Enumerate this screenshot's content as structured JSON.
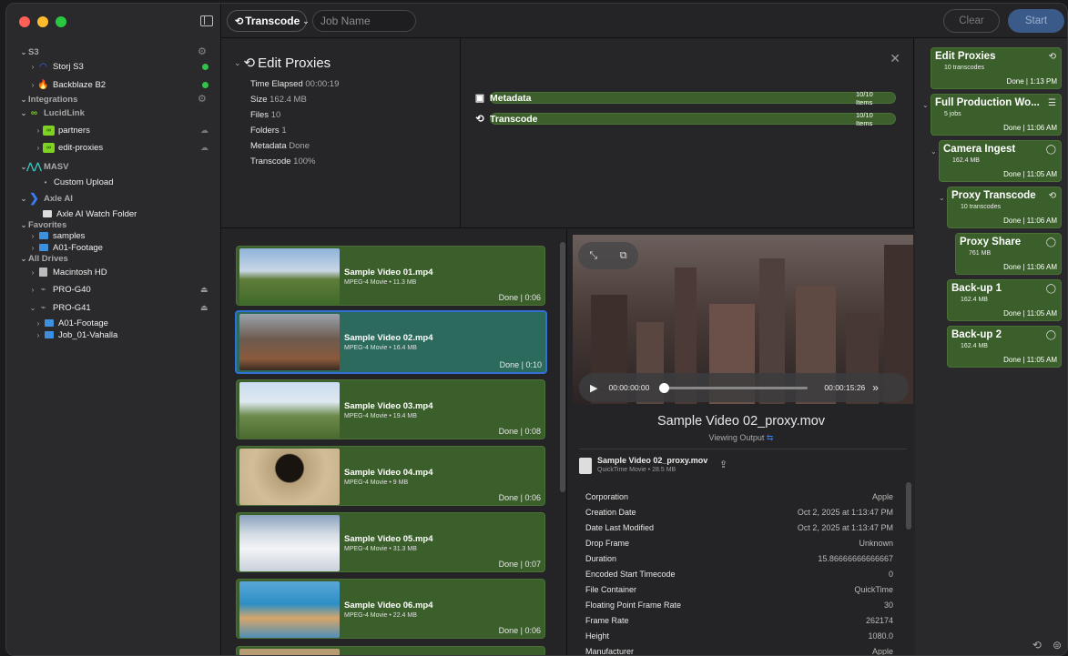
{
  "toolbar": {
    "mode": "Transcode",
    "job_name_placeholder": "Job Name",
    "clear": "Clear",
    "start": "Start"
  },
  "sidebar": {
    "s3": {
      "label": "S3",
      "items": [
        "Storj S3",
        "Backblaze B2"
      ]
    },
    "integrations": {
      "label": "Integrations"
    },
    "lucidlink": {
      "label": "LucidLink",
      "items": [
        "partners",
        "edit-proxies"
      ]
    },
    "masv": {
      "label": "MASV",
      "items": [
        "Custom Upload"
      ]
    },
    "axle": {
      "label": "Axle AI",
      "items": [
        "Axle AI Watch Folder"
      ]
    },
    "favorites": {
      "label": "Favorites",
      "items": [
        "samples",
        "A01-Footage"
      ]
    },
    "drives": {
      "label": "All Drives",
      "items": [
        "Macintosh HD",
        "PRO-G40",
        "PRO-G41"
      ],
      "sub": [
        "A01-Footage",
        "Job_01-Vahalla"
      ]
    }
  },
  "summary": {
    "title": "Edit Proxies",
    "rows": [
      {
        "k": "Time Elapsed",
        "v": "00:00:19"
      },
      {
        "k": "Size",
        "v": "162.4 MB"
      },
      {
        "k": "Files",
        "v": "10"
      },
      {
        "k": "Folders",
        "v": "1"
      },
      {
        "k": "Metadata",
        "v": "Done"
      },
      {
        "k": "Transcode",
        "v": "100%"
      }
    ]
  },
  "tasks": [
    {
      "name": "Metadata",
      "count": "10/10 Items",
      "progress": 1.0
    },
    {
      "name": "Transcode",
      "count": "10/10 Items",
      "progress": 1.0
    }
  ],
  "files": [
    {
      "name": "Sample Video 01.mp4",
      "meta": "MPEG-4 Movie • 11.3 MB",
      "status": "Done | 0:06"
    },
    {
      "name": "Sample Video 02.mp4",
      "meta": "MPEG-4 Movie • 16.4 MB",
      "status": "Done | 0:10"
    },
    {
      "name": "Sample Video 03.mp4",
      "meta": "MPEG-4 Movie • 19.4 MB",
      "status": "Done | 0:08"
    },
    {
      "name": "Sample Video 04.mp4",
      "meta": "MPEG-4 Movie • 9 MB",
      "status": "Done | 0:06"
    },
    {
      "name": "Sample Video 05.mp4",
      "meta": "MPEG-4 Movie • 31.3 MB",
      "status": "Done | 0:07"
    },
    {
      "name": "Sample Video 06.mp4",
      "meta": "MPEG-4 Movie • 22.4 MB",
      "status": "Done | 0:06"
    }
  ],
  "preview": {
    "time_current": "00:00:00:00",
    "time_total": "00:00:15:26",
    "title": "Sample Video 02_proxy.mov",
    "subtitle": "Viewing Output",
    "file_name": "Sample Video 02_proxy.mov",
    "file_meta": "QuickTime Movie • 28.5 MB",
    "properties": [
      {
        "k": "Corporation",
        "v": "Apple"
      },
      {
        "k": "Creation Date",
        "v": "Oct 2, 2025 at 1:13:47 PM"
      },
      {
        "k": "Date Last Modified",
        "v": "Oct 2, 2025 at 1:13:47 PM"
      },
      {
        "k": "Drop Frame",
        "v": "Unknown"
      },
      {
        "k": "Duration",
        "v": "15.86666666666667"
      },
      {
        "k": "Encoded Start Timecode",
        "v": "0"
      },
      {
        "k": "File Container",
        "v": "QuickTime"
      },
      {
        "k": "Floating Point Frame Rate",
        "v": "30"
      },
      {
        "k": "Frame Rate",
        "v": "262174"
      },
      {
        "k": "Height",
        "v": "1080.0"
      },
      {
        "k": "Manufacturer",
        "v": "Apple"
      }
    ]
  },
  "jobs": [
    {
      "title": "Edit Proxies",
      "sub": "10 transcodes",
      "done": "Done | 1:13 PM"
    },
    {
      "title": "Full Production Wo...",
      "sub": "5 jobs",
      "done": "Done | 11:06 AM"
    },
    {
      "title": "Camera Ingest",
      "sub": "162.4 MB",
      "done": "Done | 11:05 AM"
    },
    {
      "title": "Proxy Transcode",
      "sub": "10 transcodes",
      "done": "Done | 11:06 AM"
    },
    {
      "title": "Proxy Share",
      "sub": "761 MB",
      "done": "Done | 11:06 AM"
    },
    {
      "title": "Back-up 1",
      "sub": "162.4 MB",
      "done": "Done | 11:05 AM"
    },
    {
      "title": "Back-up 2",
      "sub": "162.4 MB",
      "done": "Done | 11:05 AM"
    }
  ]
}
